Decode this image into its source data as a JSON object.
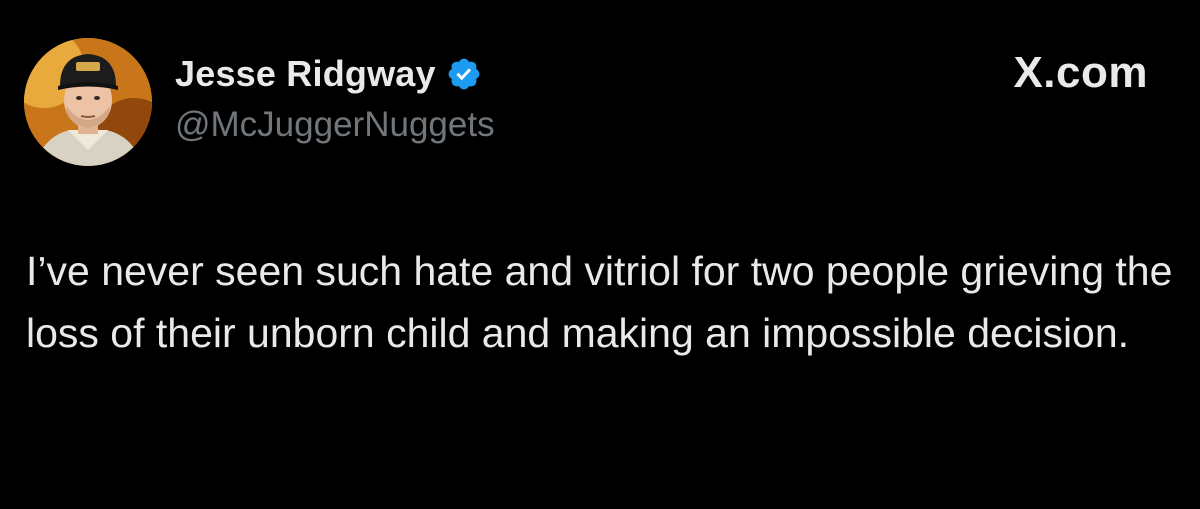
{
  "tweet": {
    "author": {
      "display_name": "Jesse Ridgway",
      "handle": "@McJuggerNuggets",
      "verified": true,
      "avatar": "profile-photo"
    },
    "brand_label": "X.com",
    "text": "I’ve never seen such hate and vitriol for two people grieving the loss of their unborn child and making an impossible decision."
  },
  "colors": {
    "background": "#000000",
    "text_primary": "#e7e9ea",
    "text_secondary": "#71767b",
    "verified_badge": "#1d9bf0"
  },
  "icons": {
    "verified": "verified-badge-icon"
  }
}
